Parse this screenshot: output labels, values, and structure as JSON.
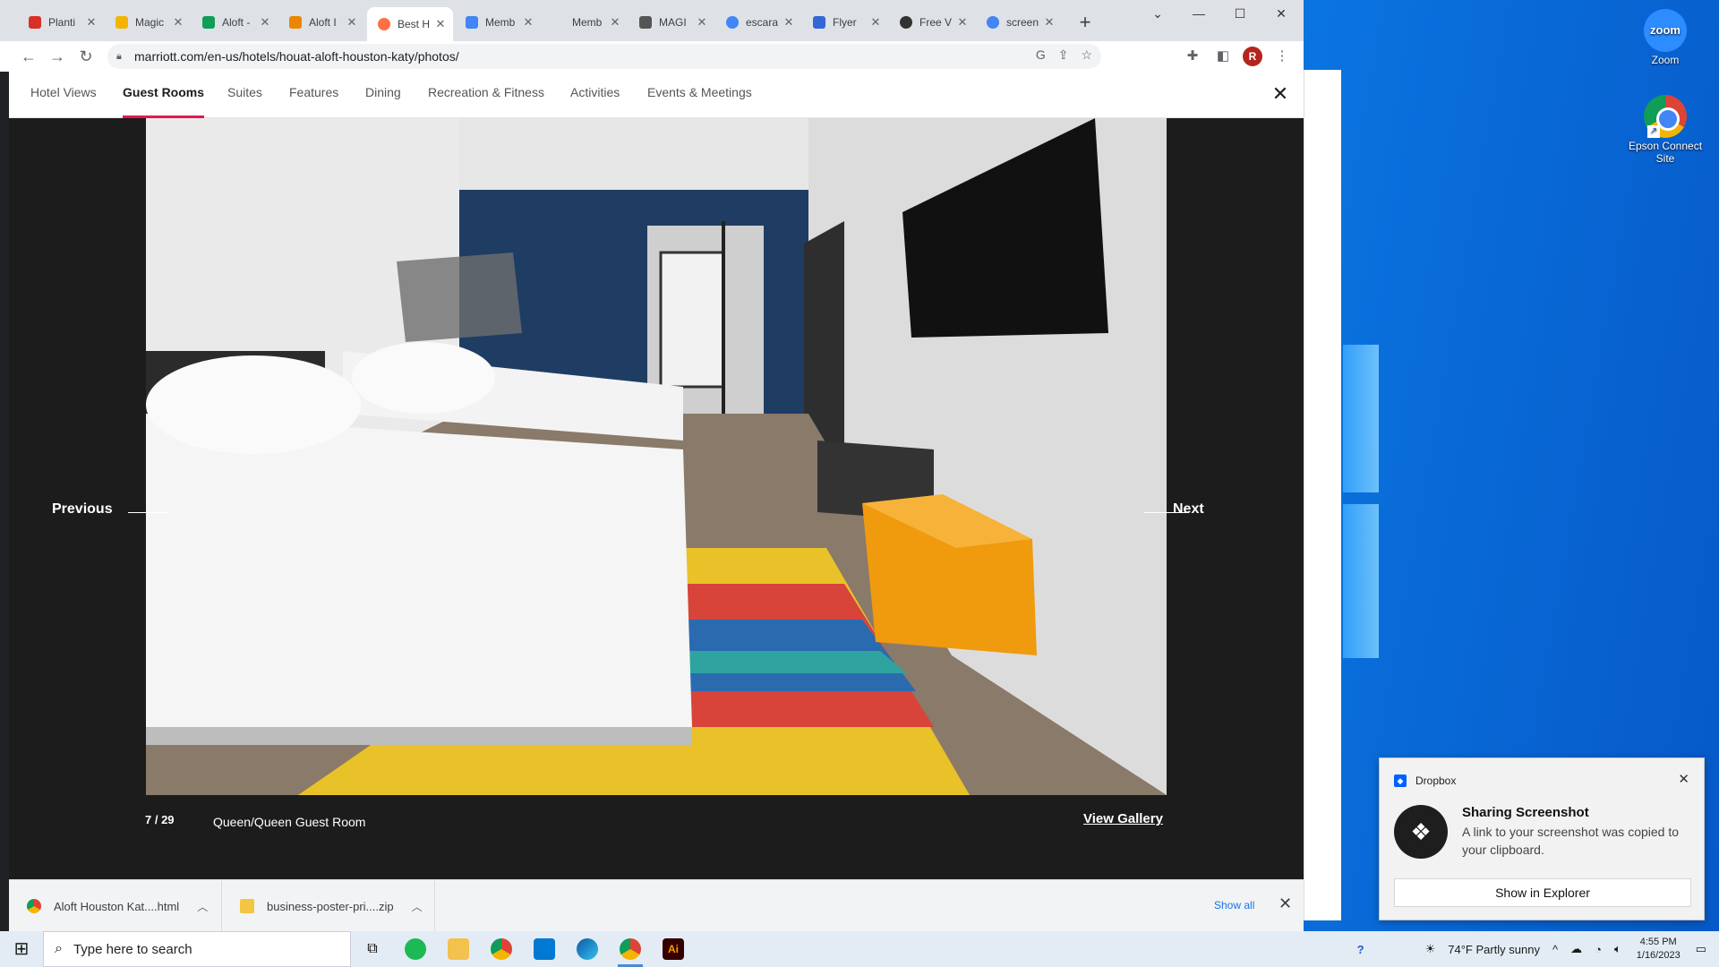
{
  "browser": {
    "tabs": [
      {
        "title": "Planti",
        "color": "#d93025"
      },
      {
        "title": "Magic",
        "color": "#f4b400"
      },
      {
        "title": "Aloft -",
        "color": "#0f9d58"
      },
      {
        "title": "Aloft I",
        "color": "#ea8600"
      },
      {
        "title": "Best H",
        "color": "#ff7043",
        "active": true
      },
      {
        "title": "Memb",
        "color": "#4285f4"
      },
      {
        "title": "Memb",
        "color": "#dee1e6"
      },
      {
        "title": "MAGI",
        "color": "#555555"
      },
      {
        "title": "escara",
        "color": "#4285f4"
      },
      {
        "title": "Flyer",
        "color": "#3367d6"
      },
      {
        "title": "Free V",
        "color": "#333333"
      },
      {
        "title": "screen",
        "color": "#4285f4"
      }
    ],
    "url": "marriott.com/en-us/hotels/houat-aloft-houston-katy/photos/",
    "profile_initial": "R"
  },
  "gallery": {
    "categories": [
      "Hotel Views",
      "Guest Rooms",
      "Suites",
      "Features",
      "Dining",
      "Recreation & Fitness",
      "Activities",
      "Events & Meetings"
    ],
    "active_category": "Guest Rooms",
    "previous_label": "Previous",
    "next_label": "Next",
    "counter": "7 / 29",
    "caption": "Queen/Queen Guest Room",
    "view_gallery_label": "View Gallery"
  },
  "downloads": {
    "items": [
      "Aloft Houston Kat....html",
      "business-poster-pri....zip"
    ],
    "show_all": "Show all"
  },
  "desktop": {
    "icons": [
      {
        "label": "Zoom",
        "glyph": "zoom"
      },
      {
        "label": "Epson Connect Site"
      }
    ]
  },
  "taskbar": {
    "search_placeholder": "Type here to search",
    "weather": "74°F  Partly sunny",
    "time": "4:55 PM",
    "date": "1/16/2023"
  },
  "toast": {
    "app": "Dropbox",
    "title": "Sharing Screenshot",
    "body": "A link to your screenshot was copied to your clipboard.",
    "button": "Show in Explorer"
  }
}
